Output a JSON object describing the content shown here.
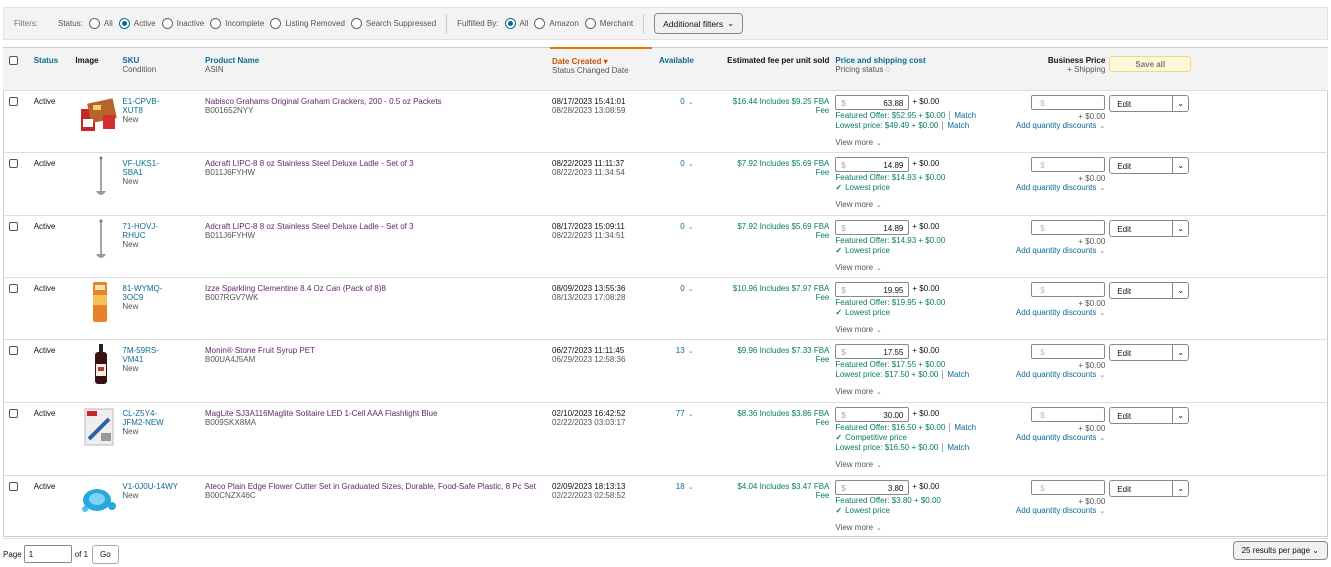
{
  "filters": {
    "label": "Filters:",
    "status_label": "Status:",
    "status_options": [
      "All",
      "Active",
      "Inactive",
      "Incomplete",
      "Listing Removed",
      "Search Suppressed"
    ],
    "status_selected": 1,
    "fulfilled_label": "Fulfilled By:",
    "fulfilled_options": [
      "All",
      "Amazon",
      "Merchant"
    ],
    "fulfilled_selected": 0,
    "additional_label": "Additional filters"
  },
  "columns": {
    "status": "Status",
    "image": "Image",
    "sku": "SKU",
    "sku_sub": "Condition",
    "product": "Product Name",
    "product_sub": "ASIN",
    "date": "Date Created",
    "date_sub": "Status Changed Date",
    "available": "Available",
    "fee": "Estimated fee per unit sold",
    "price": "Price and shipping cost",
    "price_sub": "Pricing status",
    "business": "Business Price",
    "business_sub": "+ Shipping",
    "save_all": "Save all"
  },
  "common": {
    "add_qty": "Add quantity discounts",
    "view_more": "View more",
    "edit": "Edit",
    "plus_zero": "+ $0.00",
    "currency": "$",
    "match": "Match"
  },
  "rows": [
    {
      "status": "Active",
      "image": "graham-crackers-box-image",
      "sku": "E1-CPVB-XUT8",
      "condition": "New",
      "product": "Nabisco Grahams Original Graham Crackers, 200 - 0.5 oz Packets",
      "asin": "B001652NYY",
      "created": "08/17/2023 15:41:01",
      "changed": "08/28/2023 13:08:59",
      "available": "0",
      "fee": "$16.44 Includes $9.25 FBA Fee",
      "price": "63.88",
      "price_ship": "+ $0.00",
      "lines": [
        {
          "text": "Featured Offer: $52.95 + $0.00",
          "match": true,
          "check": false
        },
        {
          "text": "Lowest price: $49.49 + $0.00",
          "match": true,
          "check": false
        }
      ]
    },
    {
      "status": "Active",
      "image": "ladle-image",
      "sku": "VF-UKS1-SBA1",
      "condition": "New",
      "product": "Adcraft LIPC-8 8 oz Stainless Steel Deluxe Ladle - Set of 3",
      "asin": "B011J6FYHW",
      "created": "08/22/2023 11:11:37",
      "changed": "08/22/2023 11:34:54",
      "available": "0",
      "fee": "$7.92 Includes $5.69 FBA Fee",
      "price": "14.89",
      "price_ship": "+ $0.00",
      "lines": [
        {
          "text": "Featured Offer: $14.93 + $0.00",
          "match": false,
          "check": false
        },
        {
          "text": "Lowest price",
          "match": false,
          "check": true
        }
      ]
    },
    {
      "status": "Active",
      "image": "ladle-image",
      "sku": "71-HOVJ-RHUC",
      "condition": "New",
      "product": "Adcraft LIPC-8 8 oz Stainless Steel Deluxe Ladle - Set of 3",
      "asin": "B011J6FYHW",
      "created": "08/17/2023 15:09:11",
      "changed": "08/22/2023 11:34:51",
      "available": "0",
      "fee": "$7.92 Includes $5.69 FBA Fee",
      "price": "14.89",
      "price_ship": "+ $0.00",
      "lines": [
        {
          "text": "Featured Offer: $14.93 + $0.00",
          "match": false,
          "check": false
        },
        {
          "text": "Lowest price",
          "match": false,
          "check": true
        }
      ]
    },
    {
      "status": "Active",
      "image": "izze-can-image",
      "sku": "81-WYMQ-3OC9",
      "condition": "New",
      "product": "Izze Sparkling Clementine 8.4 Oz Can (Pack of 8)8",
      "asin": "B007RGV7WK",
      "created": "08/09/2023 13:55:36",
      "changed": "08/13/2023 17:08:28",
      "available": "0",
      "fee": "$10.96 Includes $7.97 FBA Fee",
      "price": "19.95",
      "price_ship": "+ $0.00",
      "lines": [
        {
          "text": "Featured Offer: $19.95 + $0.00",
          "match": false,
          "check": false
        },
        {
          "text": "Lowest price",
          "match": false,
          "check": true
        }
      ]
    },
    {
      "status": "Active",
      "image": "syrup-bottle-image",
      "sku": "7M-59RS-VM41",
      "condition": "New",
      "product": "Monin® Stone Fruit Syrup PET",
      "asin": "B00UA4J5AM",
      "created": "06/27/2023 11:11:45",
      "changed": "06/29/2023 12:58:36",
      "available": "13",
      "fee": "$9.96 Includes $7.33 FBA Fee",
      "price": "17.55",
      "price_ship": "+ $0.00",
      "lines": [
        {
          "text": "Featured Offer: $17.55 + $0.00",
          "match": false,
          "check": false
        },
        {
          "text": "Lowest price: $17.50 + $0.00",
          "match": true,
          "check": false
        }
      ]
    },
    {
      "status": "Active",
      "image": "flashlight-pack-image",
      "sku": "CL-Z5Y4-JFM2-NEW",
      "condition": "New",
      "product": "MagLite SJ3A116Maglite Solitaire LED 1-Cell AAA Flashlight Blue",
      "asin": "B009SKX8MA",
      "created": "02/10/2023 16:42:52",
      "changed": "02/22/2023 03:03:17",
      "available": "77",
      "fee": "$8.36 Includes $3.86 FBA Fee",
      "price": "30.00",
      "price_ship": "+ $0.00",
      "lines": [
        {
          "text": "Featured Offer: $16.50 + $0.00",
          "match": true,
          "check": false
        },
        {
          "text": "Competitive price",
          "match": false,
          "check": true
        },
        {
          "text": "Lowest price: $16.50 + $0.00",
          "match": true,
          "check": false
        }
      ]
    },
    {
      "status": "Active",
      "image": "cutter-set-image",
      "sku": "V1-0J0U-14WY",
      "condition": "New",
      "product": "Ateco Plain Edge Flower Cutter Set in Graduated Sizes, Durable, Food-Safe Plastic, 8 Pc Set",
      "asin": "B00CNZX46C",
      "created": "02/09/2023 18:13:13",
      "changed": "02/22/2023 02:58:52",
      "available": "18",
      "fee": "$4.04 Includes $3.47 FBA Fee",
      "price": "3.80",
      "price_ship": "+ $0.00",
      "lines": [
        {
          "text": "Featured Offer: $3.80 + $0.00",
          "match": false,
          "check": false
        },
        {
          "text": "Lowest price",
          "match": false,
          "check": true
        }
      ]
    }
  ],
  "pagination": {
    "page_label": "Page",
    "page_value": "1",
    "of_label": "of 1",
    "go": "Go",
    "per_page": "25 results per page"
  }
}
